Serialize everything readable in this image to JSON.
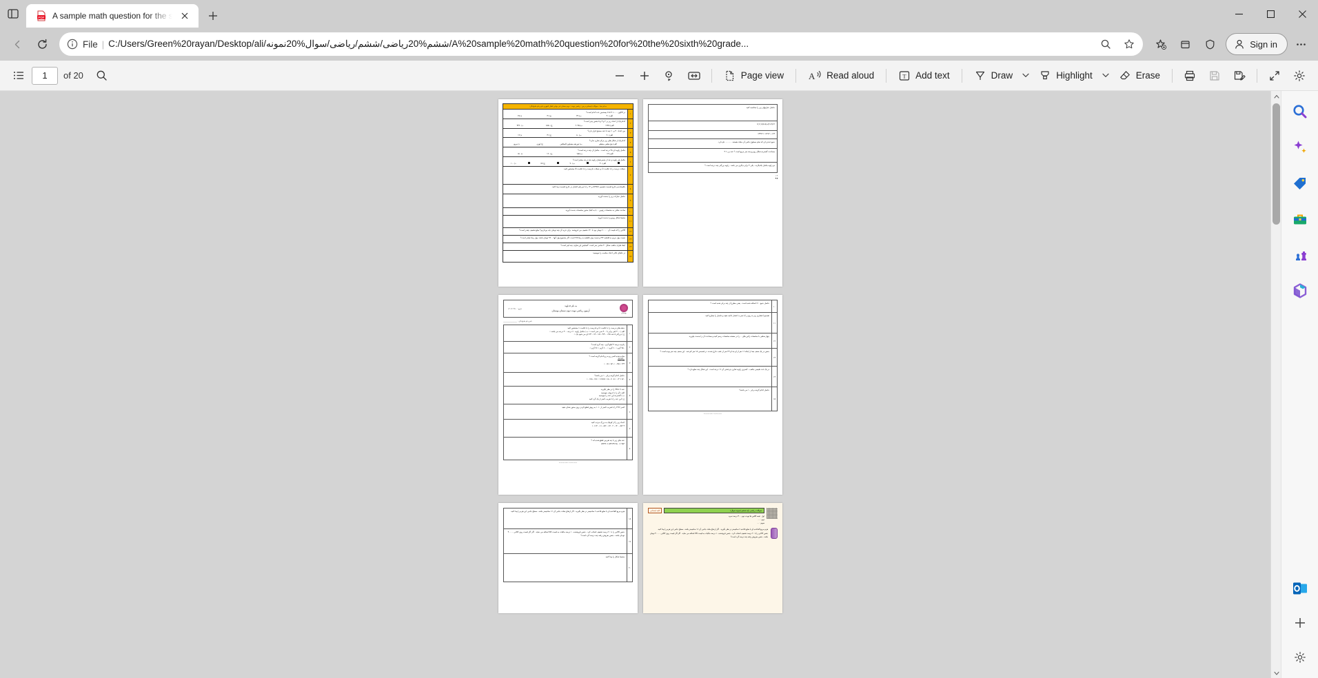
{
  "browser": {
    "tab": {
      "title": "A sample math question for the s",
      "favicon": "pdf-icon",
      "close_label": "×"
    },
    "new_tab_label": "+",
    "window_controls": {
      "minimize": "—",
      "maximize": "□",
      "close": "×"
    },
    "omnibox": {
      "scheme_label": "File",
      "separator": "|",
      "url": "C:/Users/Green%20rayan/Desktop/ali/ششم%20ریاضی/ششم/ریاضی/سوال%20نمونه/A%20sample%20math%20question%20for%20the%20sixth%20grade..."
    },
    "signin_label": "Sign in"
  },
  "pdf_toolbar": {
    "page_current": "1",
    "page_total": "of 20",
    "buttons": [
      {
        "name": "table-of-contents",
        "label": ""
      },
      {
        "name": "search",
        "label": ""
      },
      {
        "name": "zoom-out",
        "label": ""
      },
      {
        "name": "zoom-in",
        "label": ""
      },
      {
        "name": "rotate",
        "label": ""
      },
      {
        "name": "fit-width",
        "label": ""
      },
      {
        "name": "page-view",
        "label": "Page view"
      },
      {
        "name": "read-aloud",
        "label": "Read aloud"
      },
      {
        "name": "add-text",
        "label": "Add text"
      },
      {
        "name": "draw",
        "label": "Draw"
      },
      {
        "name": "highlight",
        "label": "Highlight"
      },
      {
        "name": "erase",
        "label": "Erase"
      },
      {
        "name": "print",
        "label": ""
      },
      {
        "name": "save",
        "label": ""
      },
      {
        "name": "save-as",
        "label": ""
      },
      {
        "name": "fullscreen",
        "label": ""
      },
      {
        "name": "settings",
        "label": ""
      }
    ],
    "page_view_label": "Page view",
    "read_aloud_label": "Read aloud",
    "add_text_label": "Add text",
    "draw_label": "Draw",
    "highlight_label": "Highlight",
    "erase_label": "Erase"
  },
  "sidebar": {
    "items": [
      {
        "name": "search-icon",
        "label": "Search"
      },
      {
        "name": "copilot-icon",
        "label": "Copilot"
      },
      {
        "name": "shopping-tag-icon",
        "label": "Shopping"
      },
      {
        "name": "tools-icon",
        "label": "Tools"
      },
      {
        "name": "games-icon",
        "label": "Games"
      },
      {
        "name": "microsoft365-icon",
        "label": "Microsoft 365"
      },
      {
        "name": "outlook-icon",
        "label": "Outlook"
      }
    ],
    "add_label": "+",
    "settings_label": "Settings"
  },
  "document": {
    "page1": {
      "header": "به نام خدا - سوالات امتحانی درس : ریاضی      نوبت : دوم      دبستان غیر دولتی اقبال لاهوری    نام و نام خانوادگی:",
      "questions": [
        {
          "n": "١",
          "text": "در الگوی ......،٧،٥،٣،١ بیستمین عدد کدام است؟",
          "opts": [
            "الف) ۴٠",
            "ب) ٣٩",
            "ج) ۴١",
            "د) ٣٨"
          ]
        },
        {
          "n": "٢",
          "text": "کدام یک از اعداد زیر بر ٢ و ٣ و ۵ بخش پذیر است؟",
          "opts": [
            "الف) ١٢٣٨",
            "ب) ٢٠۴۵",
            "ج) ۶٨۵٠",
            "د) ۴٣٢٠"
          ]
        },
        {
          "n": "٣",
          "text": "بین اعداد ۴٠ و ۶٠ چند تا عدد صحیح قرار دارد؟",
          "opts": [
            "الف) ٢٠",
            "ب) ٨٠",
            "ج) ۴١",
            "د) ١٩"
          ]
        },
        {
          "n": "۴",
          "text": "کدام یک از شکل های زیر مرکز تقارن ندارد؟",
          "opts": [
            "الف) پنج ضلعی منتظم",
            "ب) ذوزنقه متساوی الساقین",
            "ج) لوزی",
            "د) مربع"
          ]
        },
        {
          "n": "۵",
          "text": "مکمل زاویه ای ۲۸ درجه است ، مکمل آن چند درجه است؟",
          "opts": [
            "الف) ۶٢",
            "ب) ١۵٨",
            "ج) ١٢٠",
            "د) ١۵٠"
          ]
        },
        {
          "n": "۶",
          "text": "مکمل هر زاویه ی تند از متمم همان زاویه چند درجه بیشتر است؟",
          "opts": [
            "الف) ۴٠",
            "ب) ٩٠",
            "ج) ۶۵",
            "د) ١٠٠"
          ]
        },
        {
          "n": "٧",
          "text": "جملات درست را با علامت ☑ و جملات نادرست را با علامت ☒ مشخص کنید.",
          "opts": []
        },
        {
          "n": "٨",
          "text": "باقیمانده و خارج قسمت تقسیم ۵/۹۹۵۱ بر ۱۴ را با دو رقم اعشار در خارج قسمت پیدا کنید.",
          "opts": []
        },
        {
          "n": "٩",
          "text": "حاصل عبارات زیر را بدست آورید.",
          "opts": []
        },
        {
          "n": "١٠",
          "text": "ساعت مثلثی به مختصات رئوس ... با به کمک محور مختصات بدست آورید.",
          "opts": []
        },
        {
          "n": "١١",
          "text": "محیط شکل روبرو را بدست آورید.",
          "opts": []
        },
        {
          "n": "١٢",
          "text": "کالایی را که قیمت آن ۶۰۰۰۰ تومان بود با ۳۰٪ تخفیف می فروشند. برای خرید آن چند تومان باید بپردازیم؟ مبلغ تخفیف چقدر است؟",
          "opts": []
        },
        {
          "n": "١٣",
          "text": "نسبت پول مریم به فاطمه ٣/۴ و نسبت پول فاطمه به رضا ٢/۵ است. اگر مجموع پول آنها ٩٢٠٠ تومان باشد، پول رضا چقدر است؟",
          "opts": []
        },
        {
          "n": "١۴",
          "text": "ابعاد ظرف مکعب شکل ٣٠ سانتی متر است. گنجایش این ظرف چند لیتر است؟",
          "opts": []
        },
        {
          "n": "١۵",
          "text": "در جاهای خالی اعداد مناسب را بنویسید:",
          "opts": []
        }
      ]
    },
    "page2": {
      "lines": [
        "حاصل عبارتهای زیر را محاسبه کنید",
        "٢×(٩+٢)+(٨-۵)×(١١)=",
        "٣/۶ ÷ ٢×١/٣ = ٢/۴۴=",
        "جمع عددی ای که تمام سطوح جانبی آن مثلث هستند ............ نام دارد.",
        "مساحت گسترده شکل روبرو چند متر مربع است ؟ عدد پی = ٣",
        "دو زاویه مکمل یکدیگرند ، یکی ۴ برابر دیگری می باشد . زاویه بزرگتر چند درجه است ؟",
        "حاصل جمع ۱۰٪ اضافه شده است . یعنی مطرح از چند برابر شده است ؟",
        "تقسیم اعشاری زیر به روی را با ضرب اعشار ادامه دهید و حاصل را مطرح کنید.",
        "چهار ضلعی با مختصات رأس های ... را در صفحه مختصات رسم کنید و مساحت آن را بدست بیاورید.",
        "جنس در یک صنف بعد از اینکه ۱۶ نفر از او جدا و ۲۴ نفر از عقب خارج شدند. در قسمتی ۱۵ نفر کم شد . این صنف چند نفر بوده است ؟",
        "در یک عدد طبیعی مکعب ، کمترین زاویه تقارن چرخشی آن ۱۶ درجه است . این شکل چند ضلع دارد ؟"
      ]
    },
    "page3": {
      "header_title": "آزمون ریاضی نوبت دوم دبستان بوستان",
      "header_sub": "به نام خداوند",
      "header_school": "بوستان",
      "header_date": "تاریخ : ١۴٠٢/٠٣/١٠",
      "header_name_field": "نام و نام خانوادگی : ______________",
      "questions": [
        {
          "n": "١",
          "text": "جمله های درست را با علامت ☑ و نادرست را با علامت × مشخص کنید",
          "opts": [
            "الف ) ۴٠٠ لیتر برابر با ۴٠٠ سی سی است ○",
            "ب ) مکمل زاویه ۶٠ درجه ، ٣٠ درجه می باشد ○",
            "ج ) بزرگتر ۵ عدد ٠/٧۵ ، ٣/۴ ، ١/۵ ، ١/٢ ، ٢/٣ ای می شود یک ○"
          ]
        },
        {
          "n": "٢",
          "text": "پانزده درصد ۴ کیلو گرم ، چند گرم است؟",
          "opts": [
            "٩۵٠ گرم ○",
            "۶٠ گرم ○",
            "۶٠٠ گرم ○",
            "٩۶ گرم ○"
          ]
        },
        {
          "n": "٣",
          "text": "ساده شده کسر رو به رو کدام گزینه است ؟",
          "opts": [
            "٣/۴ ○",
            "٠/٧۵ ○",
            "١/۵ ○",
            "۵/٠ ○"
          ]
        },
        {
          "n": "۴",
          "text": "حاصل کدام گزینه برابر ١٠ می باشد؟",
          "opts": [
            "٠/۵ × ٠/٢ ○",
            "٠/١٠۵÷۵ ○",
            "۵×١/١۵ ○",
            "٠/١۵÷٠/١۵ ○"
          ]
        },
        {
          "n": "۵",
          "text": "عدد ۹۴/۵۰۹ را در نظر بگیرید.",
          "opts": [
            "الف ) آن را با حروف بنویسید",
            "ب ) گسترده این عدد را بنویسید",
            "ج ) این عدد را با تقریب کمتر از یک گرد کنید"
          ]
        },
        {
          "n": "۶",
          "text": "کسر ٢٢/٧ را با تقریب کمتر از ١٠/٠ به روش قطع کردن روی محور نشان دهید",
          "opts": []
        },
        {
          "n": "٧",
          "text": "اعداد زیر را از کوچک به بزرگ مرتب کنید",
          "opts": [
            "٣ ٢/۵ ، ١۴٠ ، ٢ ١/٢٠ ، ٢/۵ ، ١=١۴٠٠=١٠"
          ]
        },
        {
          "n": "٨",
          "text": "عدد های زیر با چه تقریبی قطع شده اند ؟",
          "opts": [
            "٩٨٣ ≃ ٩٨٠      ٣٩/۵٣٢ ≃ ٣٩/۵٣"
          ]
        }
      ],
      "footer": "Scanned with CamScanner"
    },
    "page4": {
      "lines": [
        "هرم مربع القاعده ای با ضلع قاعده ۶ سانتیمتر در نظر بگیرید . اگر ارتفاع مثلث جانبی آن ۱۶ سانتیمتر باشد ، سطح جانبی این هرم را پیدا کنید.",
        "جنس کالایی را با ۲۰ درصد تخفیف انتخاب کرد ، جنس فروشنده ۱۰ درصد مالیات به قیمت کالا اضافه می نماید . اگر اگر قیمت روی کالایی ۴٠٠٠٠ تومان باشد ، جنس بفروش رفته چند درصد گرد است؟",
        "محیط شکل را پیدا کنید."
      ]
    },
    "page5": {
      "title": "کلید امتحانی",
      "green_header": "سوالات ریاضی پایه ششم (نمونه سوال)",
      "rows": [
        "اول : همه کلاس ها نوبت دوم - ۴٠ درصد نمره",
        "دوم : ....",
        "سوم : ...."
      ]
    }
  }
}
